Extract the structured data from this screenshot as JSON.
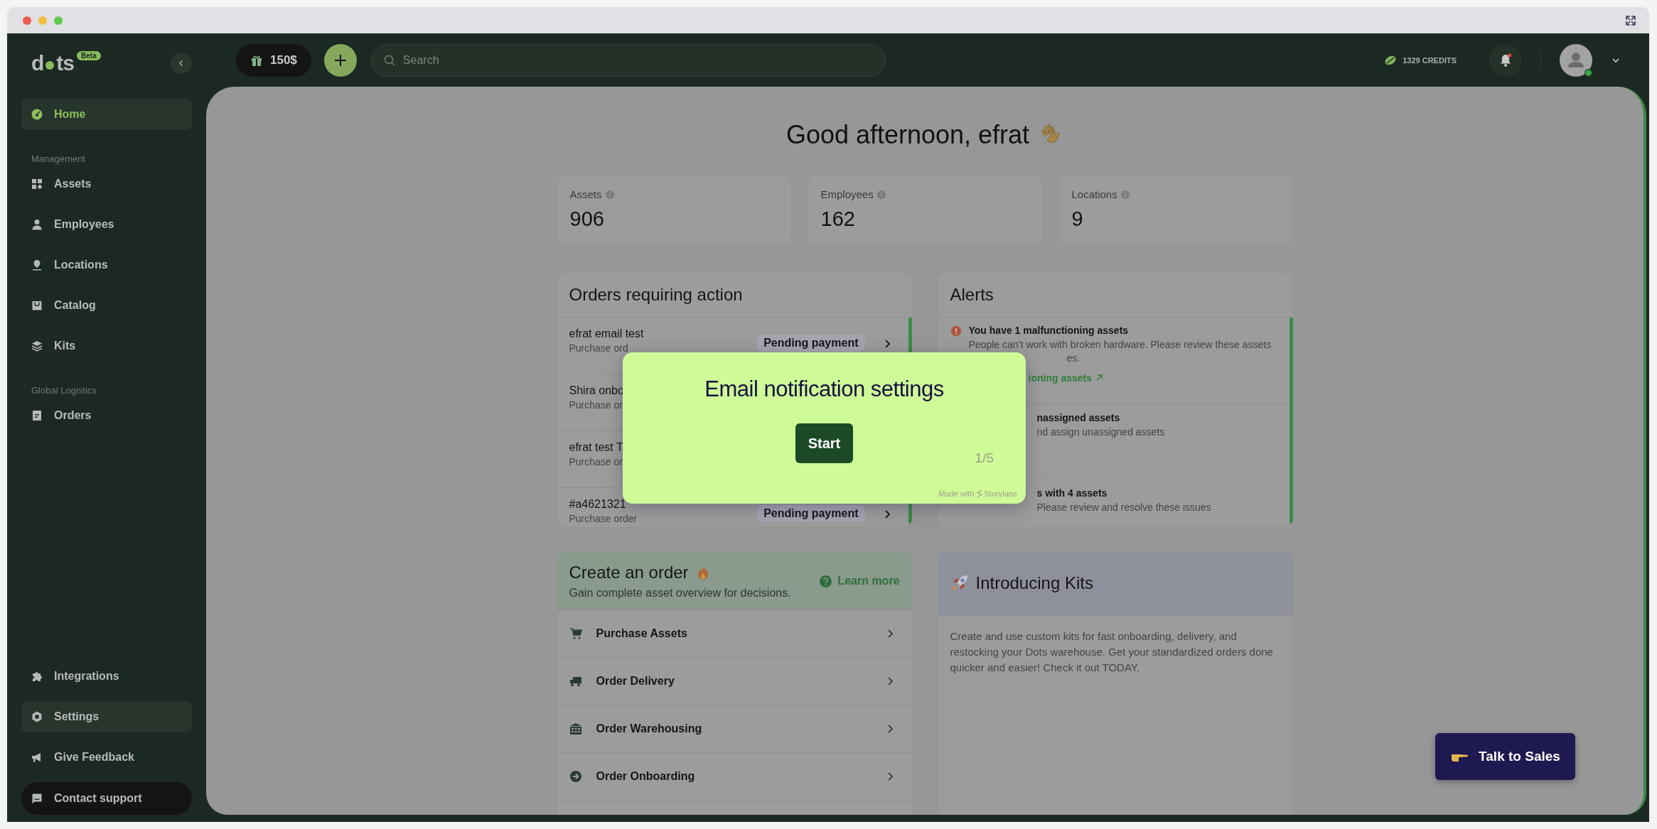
{
  "sidebar": {
    "logo": {
      "left": "d",
      "right": "ts",
      "badge": "Beta"
    },
    "sections": [
      {
        "items": [
          {
            "label": "Home",
            "selected": true
          }
        ]
      },
      {
        "heading": "Management",
        "items": [
          {
            "label": "Assets",
            "selected": false
          },
          {
            "label": "Employees",
            "selected": false
          },
          {
            "label": "Locations",
            "selected": false
          },
          {
            "label": "Catalog",
            "selected": false
          },
          {
            "label": "Kits",
            "selected": false
          }
        ]
      },
      {
        "heading": "Global Logistics",
        "items": [
          {
            "label": "Orders",
            "selected": false
          }
        ]
      }
    ],
    "bottom_items": [
      {
        "label": "Integrations",
        "hovered": false
      },
      {
        "label": "Settings",
        "hovered": true
      },
      {
        "label": "Give Feedback",
        "hovered": false
      }
    ],
    "contact": "Contact support"
  },
  "topbar": {
    "gift": "150$",
    "search": {
      "placeholder": "Search"
    },
    "credits": "1329 CREDITS",
    "notification_unread": true,
    "avatar_online": true
  },
  "greeting": "Good afternoon, efrat",
  "stats": [
    {
      "label": "Assets",
      "value": "906"
    },
    {
      "label": "Employees",
      "value": "162"
    },
    {
      "label": "Locations",
      "value": "9"
    }
  ],
  "orders": {
    "title": "Orders requiring action",
    "rows": [
      {
        "name": "efrat email test",
        "sub": "Purchase ord",
        "status": "Pending payment"
      },
      {
        "name": "Shira onbo",
        "sub": "Purchase or"
      },
      {
        "name": "efrat test T",
        "sub": "Purchase or"
      },
      {
        "name": "#a4621321",
        "sub": "Purchase order",
        "status": "Pending payment"
      }
    ]
  },
  "alerts": {
    "title": "Alerts",
    "items": [
      {
        "title": "You have 1 malfunctioning assets",
        "desc": "People can’t work with broken hardware. Please review these assets",
        "desc_tail": "es.",
        "link": "ioning assets",
        "partial": false
      },
      {
        "title": "nassigned assets",
        "desc": "nd assign unassigned assets",
        "partial": true
      },
      {
        "title": "s with 4 assets",
        "desc": "Please review and resolve these issues",
        "partial": true
      }
    ]
  },
  "create_order": {
    "title": "Create an order",
    "subtitle": "Gain complete asset overview for decisions.",
    "learn_more": "Learn more",
    "actions": [
      "Purchase Assets",
      "Order Delivery",
      "Order Warehousing",
      "Order Onboarding"
    ]
  },
  "kits": {
    "title": "Introducing Kits",
    "body": "Create and use custom kits for fast onboarding, delivery, and restocking your Dots warehouse. Get your standardized orders done quicker and easier! Check it out TODAY."
  },
  "tour": {
    "title": "Email notification settings",
    "button": "Start",
    "step": "1/5",
    "made_with": "Made with",
    "brand": "Storylane"
  },
  "talk_to_sales": "Talk to Sales"
}
